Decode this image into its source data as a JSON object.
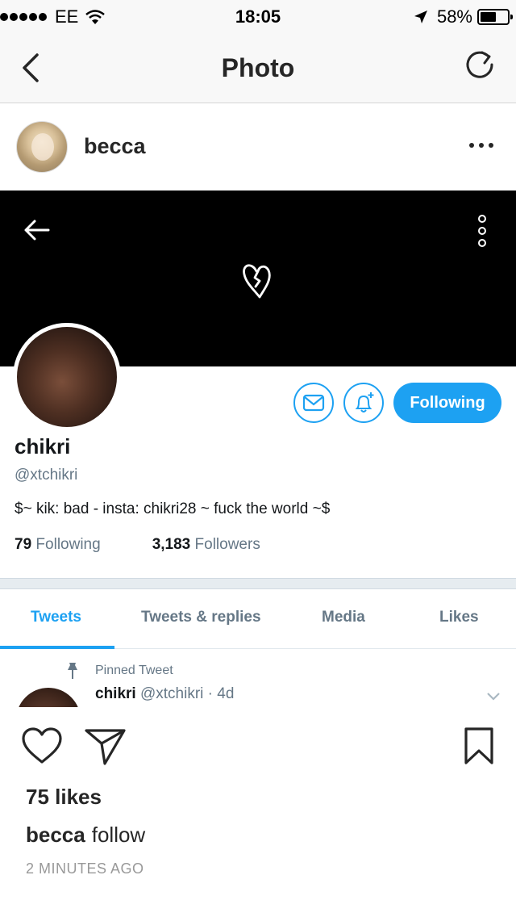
{
  "status_bar": {
    "carrier": "EE",
    "time": "18:05",
    "battery_percent": "58%",
    "battery_level": 0.58
  },
  "nav": {
    "title": "Photo",
    "back_icon": "chevron-left-icon",
    "refresh_icon": "refresh-icon"
  },
  "post": {
    "username": "becca",
    "more_icon": "more-horizontal-icon"
  },
  "photo": {
    "profile_name": "chikri",
    "profile_handle": "@xtchikri",
    "bio": "$~ kik: bad - insta: chikri28 ~ fuck the world ~$",
    "following_count": "79",
    "following_label": "Following",
    "followers_count": "3,183",
    "followers_label": "Followers",
    "follow_button": "Following",
    "tabs": [
      "Tweets",
      "Tweets & replies",
      "Media",
      "Likes"
    ],
    "active_tab": "Tweets",
    "pinned_label": "Pinned Tweet",
    "tweet_author": "chikri",
    "tweet_handle": "@xtchikri",
    "tweet_age": "· 4d",
    "accent_color": "#1da1f2"
  },
  "engagement": {
    "likes": "75 likes",
    "caption_user": "becca",
    "caption_text": "follow",
    "time_ago": "2 MINUTES AGO"
  }
}
